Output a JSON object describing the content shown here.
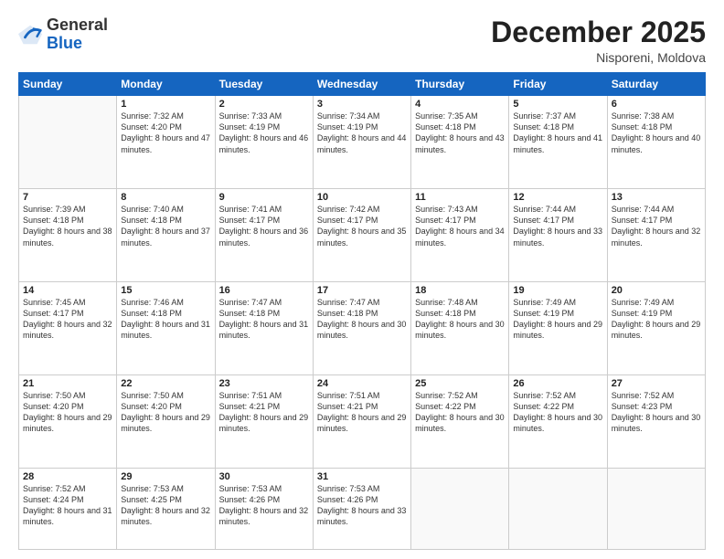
{
  "logo": {
    "general": "General",
    "blue": "Blue"
  },
  "header": {
    "month": "December 2025",
    "location": "Nisporeni, Moldova"
  },
  "weekdays": [
    "Sunday",
    "Monday",
    "Tuesday",
    "Wednesday",
    "Thursday",
    "Friday",
    "Saturday"
  ],
  "weeks": [
    [
      {
        "day": "",
        "empty": true
      },
      {
        "day": "1",
        "sunrise": "7:32 AM",
        "sunset": "4:20 PM",
        "daylight": "8 hours and 47 minutes."
      },
      {
        "day": "2",
        "sunrise": "7:33 AM",
        "sunset": "4:19 PM",
        "daylight": "8 hours and 46 minutes."
      },
      {
        "day": "3",
        "sunrise": "7:34 AM",
        "sunset": "4:19 PM",
        "daylight": "8 hours and 44 minutes."
      },
      {
        "day": "4",
        "sunrise": "7:35 AM",
        "sunset": "4:18 PM",
        "daylight": "8 hours and 43 minutes."
      },
      {
        "day": "5",
        "sunrise": "7:37 AM",
        "sunset": "4:18 PM",
        "daylight": "8 hours and 41 minutes."
      },
      {
        "day": "6",
        "sunrise": "7:38 AM",
        "sunset": "4:18 PM",
        "daylight": "8 hours and 40 minutes."
      }
    ],
    [
      {
        "day": "7",
        "sunrise": "7:39 AM",
        "sunset": "4:18 PM",
        "daylight": "8 hours and 38 minutes."
      },
      {
        "day": "8",
        "sunrise": "7:40 AM",
        "sunset": "4:18 PM",
        "daylight": "8 hours and 37 minutes."
      },
      {
        "day": "9",
        "sunrise": "7:41 AM",
        "sunset": "4:17 PM",
        "daylight": "8 hours and 36 minutes."
      },
      {
        "day": "10",
        "sunrise": "7:42 AM",
        "sunset": "4:17 PM",
        "daylight": "8 hours and 35 minutes."
      },
      {
        "day": "11",
        "sunrise": "7:43 AM",
        "sunset": "4:17 PM",
        "daylight": "8 hours and 34 minutes."
      },
      {
        "day": "12",
        "sunrise": "7:44 AM",
        "sunset": "4:17 PM",
        "daylight": "8 hours and 33 minutes."
      },
      {
        "day": "13",
        "sunrise": "7:44 AM",
        "sunset": "4:17 PM",
        "daylight": "8 hours and 32 minutes."
      }
    ],
    [
      {
        "day": "14",
        "sunrise": "7:45 AM",
        "sunset": "4:17 PM",
        "daylight": "8 hours and 32 minutes."
      },
      {
        "day": "15",
        "sunrise": "7:46 AM",
        "sunset": "4:18 PM",
        "daylight": "8 hours and 31 minutes."
      },
      {
        "day": "16",
        "sunrise": "7:47 AM",
        "sunset": "4:18 PM",
        "daylight": "8 hours and 31 minutes."
      },
      {
        "day": "17",
        "sunrise": "7:47 AM",
        "sunset": "4:18 PM",
        "daylight": "8 hours and 30 minutes."
      },
      {
        "day": "18",
        "sunrise": "7:48 AM",
        "sunset": "4:18 PM",
        "daylight": "8 hours and 30 minutes."
      },
      {
        "day": "19",
        "sunrise": "7:49 AM",
        "sunset": "4:19 PM",
        "daylight": "8 hours and 29 minutes."
      },
      {
        "day": "20",
        "sunrise": "7:49 AM",
        "sunset": "4:19 PM",
        "daylight": "8 hours and 29 minutes."
      }
    ],
    [
      {
        "day": "21",
        "sunrise": "7:50 AM",
        "sunset": "4:20 PM",
        "daylight": "8 hours and 29 minutes."
      },
      {
        "day": "22",
        "sunrise": "7:50 AM",
        "sunset": "4:20 PM",
        "daylight": "8 hours and 29 minutes."
      },
      {
        "day": "23",
        "sunrise": "7:51 AM",
        "sunset": "4:21 PM",
        "daylight": "8 hours and 29 minutes."
      },
      {
        "day": "24",
        "sunrise": "7:51 AM",
        "sunset": "4:21 PM",
        "daylight": "8 hours and 29 minutes."
      },
      {
        "day": "25",
        "sunrise": "7:52 AM",
        "sunset": "4:22 PM",
        "daylight": "8 hours and 30 minutes."
      },
      {
        "day": "26",
        "sunrise": "7:52 AM",
        "sunset": "4:22 PM",
        "daylight": "8 hours and 30 minutes."
      },
      {
        "day": "27",
        "sunrise": "7:52 AM",
        "sunset": "4:23 PM",
        "daylight": "8 hours and 30 minutes."
      }
    ],
    [
      {
        "day": "28",
        "sunrise": "7:52 AM",
        "sunset": "4:24 PM",
        "daylight": "8 hours and 31 minutes."
      },
      {
        "day": "29",
        "sunrise": "7:53 AM",
        "sunset": "4:25 PM",
        "daylight": "8 hours and 32 minutes."
      },
      {
        "day": "30",
        "sunrise": "7:53 AM",
        "sunset": "4:26 PM",
        "daylight": "8 hours and 32 minutes."
      },
      {
        "day": "31",
        "sunrise": "7:53 AM",
        "sunset": "4:26 PM",
        "daylight": "8 hours and 33 minutes."
      },
      {
        "day": "",
        "empty": true
      },
      {
        "day": "",
        "empty": true
      },
      {
        "day": "",
        "empty": true
      }
    ]
  ]
}
